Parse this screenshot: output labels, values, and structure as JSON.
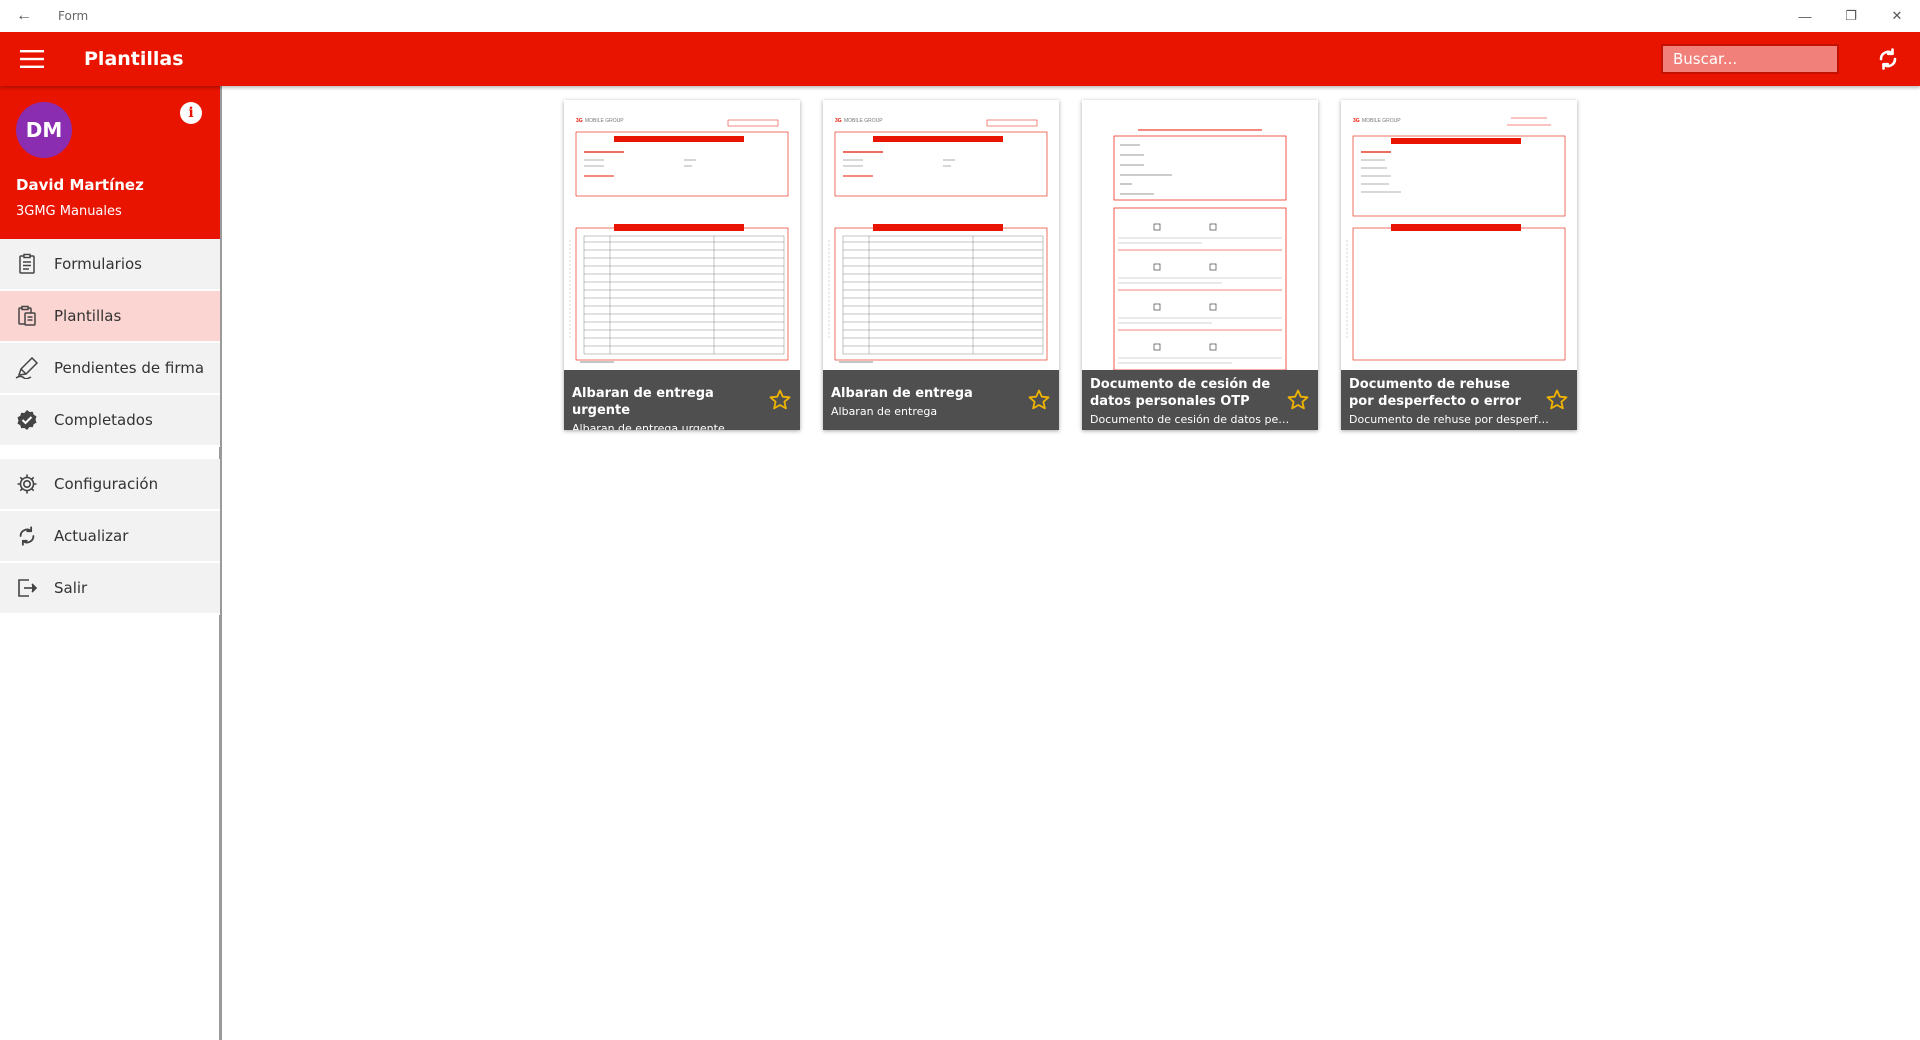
{
  "window": {
    "title": "Form",
    "back_glyph": "←",
    "min_glyph": "—",
    "max_glyph": "❐",
    "close_glyph": "✕"
  },
  "appbar": {
    "title": "Plantillas",
    "search_placeholder": "Buscar...",
    "accent": "#e81400"
  },
  "profile": {
    "initials": "DM",
    "name": "David Martínez",
    "organization": "3GMG Manuales",
    "avatar_color": "#8a2db0",
    "info_glyph": "i"
  },
  "nav": {
    "items": [
      {
        "label": "Formularios",
        "icon": "clipboard-list-icon"
      },
      {
        "label": "Plantillas",
        "icon": "clipboard-copy-icon",
        "active": true
      },
      {
        "label": "Pendientes de firma",
        "icon": "pen-icon"
      },
      {
        "label": "Completados",
        "icon": "check-badge-icon"
      },
      {
        "label": "Configuración",
        "icon": "gear-icon"
      },
      {
        "label": "Actualizar",
        "icon": "sync-icon"
      },
      {
        "label": "Salir",
        "icon": "exit-icon"
      }
    ]
  },
  "templates": [
    {
      "title": "Albaran de entrega urgente",
      "subtitle": "Albaran de entrega urgente"
    },
    {
      "title": "Albaran de entrega",
      "subtitle": "Albaran de entrega"
    },
    {
      "title": "Documento de cesión de datos personales OTP",
      "subtitle": "Documento de cesión de datos pers..."
    },
    {
      "title": "Documento de rehuse por desperfecto o error",
      "subtitle": "Documento de rehuse por desperfec..."
    }
  ],
  "star_color": "#f0b400"
}
